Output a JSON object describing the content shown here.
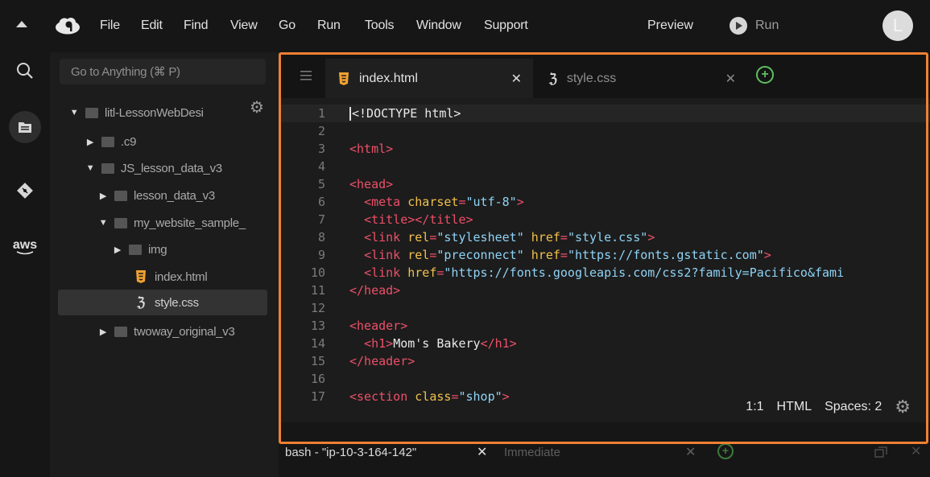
{
  "menubar": {
    "items": [
      "File",
      "Edit",
      "Find",
      "View",
      "Go",
      "Run",
      "Tools",
      "Window",
      "Support"
    ],
    "preview": "Preview",
    "run": "Run",
    "avatar_letter": "L"
  },
  "sidebar": {
    "rail_icons": [
      "search-icon",
      "files-icon",
      "git-icon",
      "aws-icon"
    ],
    "aws_label": "aws"
  },
  "filetree": {
    "search_placeholder": "Go to Anything (⌘ P)",
    "rows": [
      {
        "label": "litl-LessonWebDesi",
        "type": "folder",
        "expanded": true
      },
      {
        "label": ".c9",
        "type": "folder",
        "expanded": false
      },
      {
        "label": "JS_lesson_data_v3",
        "type": "folder",
        "expanded": true
      },
      {
        "label": "lesson_data_v3",
        "type": "folder",
        "expanded": false
      },
      {
        "label": "my_website_sample_",
        "type": "folder",
        "expanded": true
      },
      {
        "label": "img",
        "type": "folder",
        "expanded": false
      },
      {
        "label": "index.html",
        "type": "html-file"
      },
      {
        "label": "style.css",
        "type": "css-file",
        "selected": true
      },
      {
        "label": "twoway_original_v3",
        "type": "folder",
        "expanded": false
      }
    ]
  },
  "editor": {
    "tabs": [
      {
        "label": "index.html",
        "active": true
      },
      {
        "label": "style.css",
        "active": false
      }
    ],
    "code": [
      {
        "n": "1",
        "parts": [
          [
            "txt",
            "!DOCTYPE html>"
          ]
        ],
        "caret": true,
        "prefix": "<"
      },
      {
        "n": "2",
        "parts": []
      },
      {
        "n": "3",
        "parts": [
          [
            "tag",
            "<html>"
          ]
        ]
      },
      {
        "n": "4",
        "parts": []
      },
      {
        "n": "5",
        "parts": [
          [
            "tag",
            "<head>"
          ]
        ]
      },
      {
        "n": "6",
        "parts": [
          [
            "txt",
            "  "
          ],
          [
            "tag",
            "<meta "
          ],
          [
            "attr",
            "charset"
          ],
          [
            "tag",
            "="
          ],
          [
            "str",
            "\"utf-8\""
          ],
          [
            "tag",
            ">"
          ]
        ]
      },
      {
        "n": "7",
        "parts": [
          [
            "txt",
            "  "
          ],
          [
            "tag",
            "<title></title>"
          ]
        ]
      },
      {
        "n": "8",
        "parts": [
          [
            "txt",
            "  "
          ],
          [
            "tag",
            "<link "
          ],
          [
            "attr",
            "rel"
          ],
          [
            "tag",
            "="
          ],
          [
            "str",
            "\"stylesheet\""
          ],
          [
            "txt",
            " "
          ],
          [
            "attr",
            "href"
          ],
          [
            "tag",
            "="
          ],
          [
            "str",
            "\"style.css\""
          ],
          [
            "tag",
            ">"
          ]
        ]
      },
      {
        "n": "9",
        "parts": [
          [
            "txt",
            "  "
          ],
          [
            "tag",
            "<link "
          ],
          [
            "attr",
            "rel"
          ],
          [
            "tag",
            "="
          ],
          [
            "str",
            "\"preconnect\""
          ],
          [
            "txt",
            " "
          ],
          [
            "attr",
            "href"
          ],
          [
            "tag",
            "="
          ],
          [
            "str",
            "\"https://fonts.gstatic.com\""
          ],
          [
            "tag",
            ">"
          ]
        ]
      },
      {
        "n": "10",
        "parts": [
          [
            "txt",
            "  "
          ],
          [
            "tag",
            "<link "
          ],
          [
            "attr",
            "href"
          ],
          [
            "tag",
            "="
          ],
          [
            "str",
            "\"https://fonts.googleapis.com/css2?family=Pacifico&fami"
          ]
        ]
      },
      {
        "n": "11",
        "parts": [
          [
            "tag",
            "</head>"
          ]
        ]
      },
      {
        "n": "12",
        "parts": []
      },
      {
        "n": "13",
        "parts": [
          [
            "tag",
            "<header>"
          ]
        ]
      },
      {
        "n": "14",
        "parts": [
          [
            "txt",
            "  "
          ],
          [
            "tag",
            "<h1>"
          ],
          [
            "txt",
            "Mom's Bakery"
          ],
          [
            "tag",
            "</h1>"
          ]
        ]
      },
      {
        "n": "15",
        "parts": [
          [
            "tag",
            "</header>"
          ]
        ]
      },
      {
        "n": "16",
        "parts": []
      },
      {
        "n": "17",
        "parts": [
          [
            "tag",
            "<section "
          ],
          [
            "attr",
            "class"
          ],
          [
            "tag",
            "="
          ],
          [
            "str",
            "\"shop\""
          ],
          [
            "tag",
            ">"
          ]
        ]
      }
    ],
    "status": {
      "position": "1:1",
      "mode": "HTML",
      "indent": "Spaces: 2"
    }
  },
  "terminal": {
    "tabs": [
      {
        "label": "bash - \"ip-10-3-164-142\"",
        "active": true
      },
      {
        "label": "Immediate",
        "active": false
      }
    ]
  },
  "colors": {
    "highlight": "#f08032",
    "tag": "#ec5069",
    "attr": "#f2c04d",
    "string": "#8fd3f5"
  }
}
